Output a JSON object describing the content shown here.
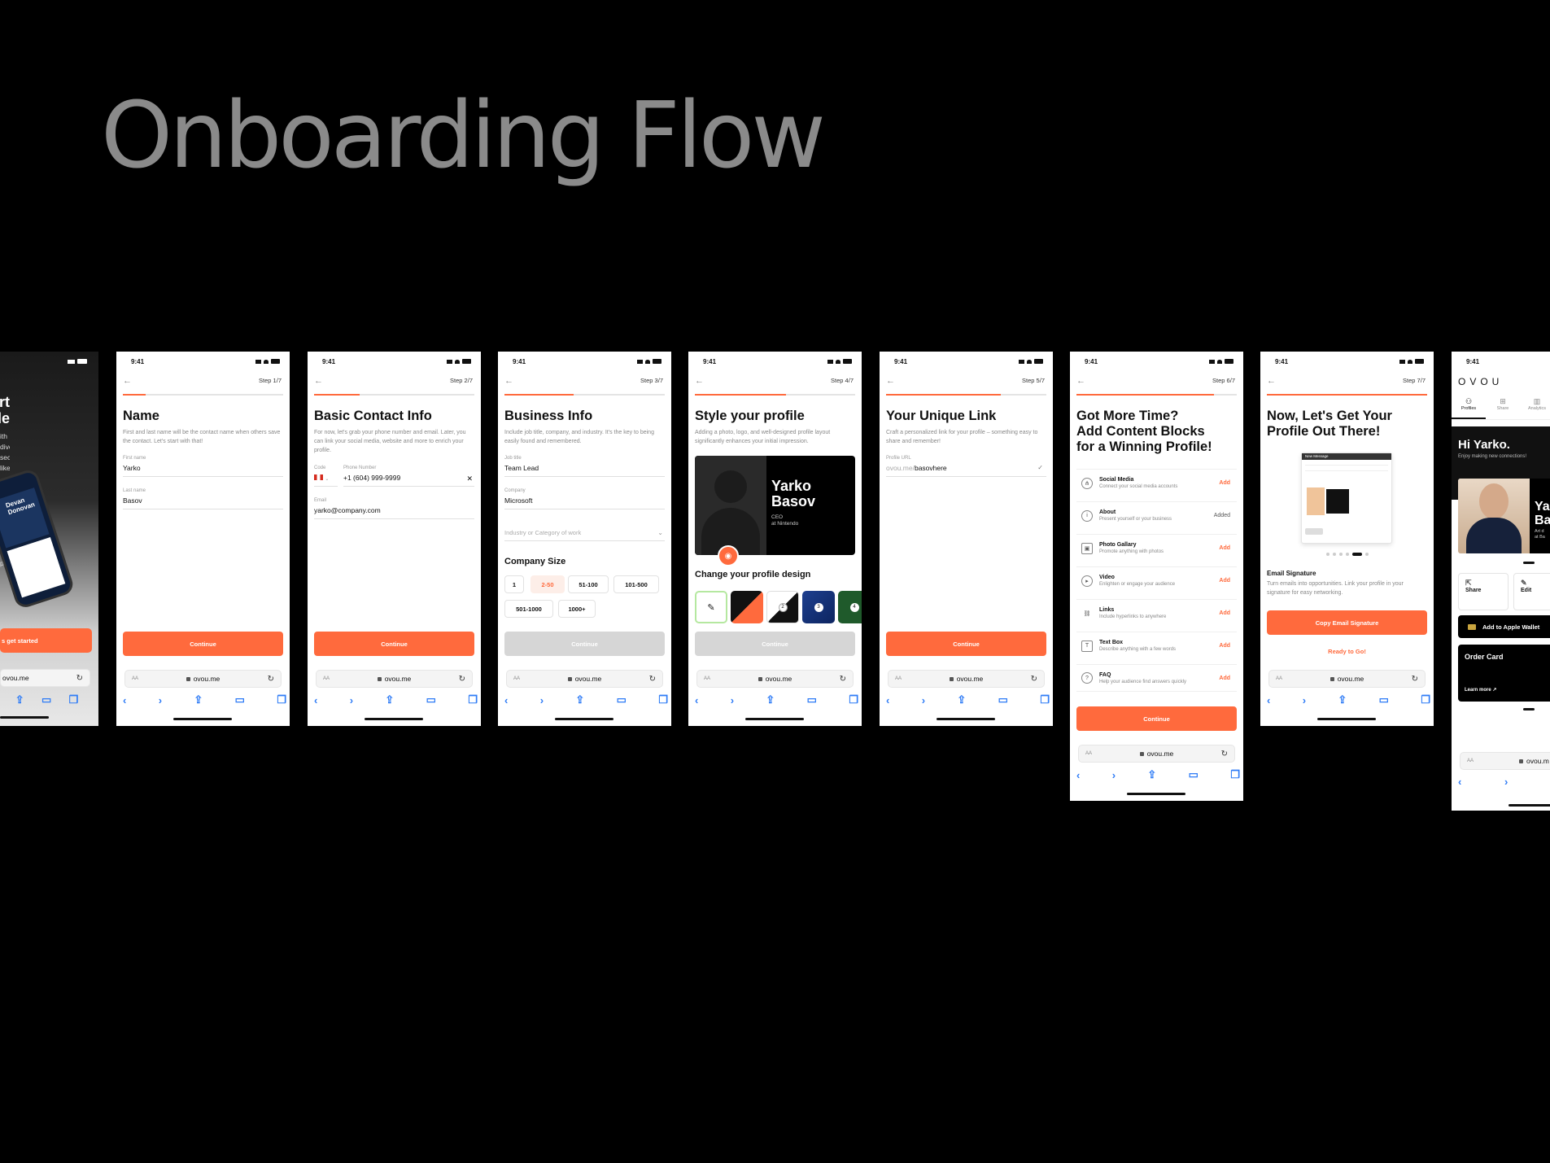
{
  "page_title": "Onboarding Flow",
  "accent": "#ff6a3d",
  "status_time": "9:41",
  "url": "ovou.me",
  "continue_label": "Continue",
  "s0": {
    "heading_l1": "s start",
    "heading_l2": "profile",
    "body": "ith diverse sections like\n, etc. Let's keep it simple\ne essential profile.",
    "cta": "s get started",
    "card_name": "Devan\nDonovan"
  },
  "s1": {
    "step": "Step 1/7",
    "title": "Name",
    "sub": "First and last name will be the contact name when others save the contact. Let's start with that!",
    "first_label": "First name",
    "first_value": "Yarko",
    "last_label": "Last name",
    "last_value": "Basov"
  },
  "s2": {
    "step": "Step 2/7",
    "title": "Basic Contact Info",
    "sub": "For now, let's grab your phone number and email. Later, you can link your social media, website and more to enrich your profile.",
    "code_label": "Code",
    "phone_label": "Phone Number",
    "phone_value": "+1 (604) 999-9999",
    "email_label": "Email",
    "email_value": "yarko@company.com"
  },
  "s3": {
    "step": "Step 3/7",
    "title": "Business Info",
    "sub": "Include job title, company, and industry. It's the key to being easily found and remembered.",
    "job_label": "Job title",
    "job_value": "Team Lead",
    "company_label": "Company",
    "company_value": "Microsoft",
    "industry_placeholder": "Industry or Category of work",
    "size_title": "Company Size",
    "sizes": [
      "1",
      "2-50",
      "51-100",
      "101-500",
      "501-1000",
      "1000+"
    ]
  },
  "s4": {
    "step": "Step 4/7",
    "title": "Style your profile",
    "sub": "Adding a photo, logo, and well-designed profile layout significantly enhances your initial impression.",
    "card_name_l1": "Yarko",
    "card_name_l2": "Basov",
    "card_role": "CEO",
    "card_company": "at Nintendo",
    "design_title": "Change your profile design",
    "swatch_numbers": [
      "2",
      "3",
      "4"
    ]
  },
  "s5": {
    "step": "Step 5/7",
    "title": "Your Unique Link",
    "sub": "Craft a personalized link for your profile – something easy to share and remember!",
    "url_label": "Profile URL",
    "url_prefix": "ovou.me/",
    "url_value": "basovhere"
  },
  "s6": {
    "step": "Step 6/7",
    "title_l1": "Got More Time?",
    "title_l2": "Add Content Blocks",
    "title_l3": "for a Winning Profile!",
    "blocks": [
      {
        "title": "Social Media",
        "desc": "Connect your social media accounts",
        "action": "Add"
      },
      {
        "title": "About",
        "desc": "Present yourself or your business",
        "action": "Added"
      },
      {
        "title": "Photo Gallary",
        "desc": "Promote anything with photos",
        "action": "Add"
      },
      {
        "title": "Video",
        "desc": "Enlighten or engage your audience",
        "action": "Add"
      },
      {
        "title": "Links",
        "desc": "Include hyperlinks to anywhere",
        "action": "Add"
      },
      {
        "title": "Text Box",
        "desc": "Describe anything with a few words",
        "action": "Add"
      },
      {
        "title": "FAQ",
        "desc": "Help your audience find answers quickly",
        "action": "Add"
      }
    ]
  },
  "s7": {
    "step": "Step 7/7",
    "title_l1": "Now, Let's Get Your",
    "title_l2": "Profile Out There!",
    "mail_header": "New Message",
    "sig_title": "Email Signature",
    "sig_desc": "Turn emails into opportunities. Link your profile in your signature for easy networking.",
    "copy_btn": "Copy Email Signature",
    "ready": "Ready to Go!"
  },
  "s8": {
    "logo": "OVOU",
    "tabs": [
      "Profiles",
      "Share",
      "Analytics"
    ],
    "greeting": "Hi Yarko.",
    "greeting_sub": "Enjoy making new connections!",
    "name_partial_l1": "Ya",
    "name_partial_l2": "Ba",
    "role_partial_l1": "Art d",
    "role_partial_l2": "at Ba",
    "share": "Share",
    "edit": "Edit",
    "wallet": "Add to Apple Wallet",
    "order_title": "Order Card",
    "learn_more": "Learn more ↗",
    "url_partial": "ovou.m"
  }
}
